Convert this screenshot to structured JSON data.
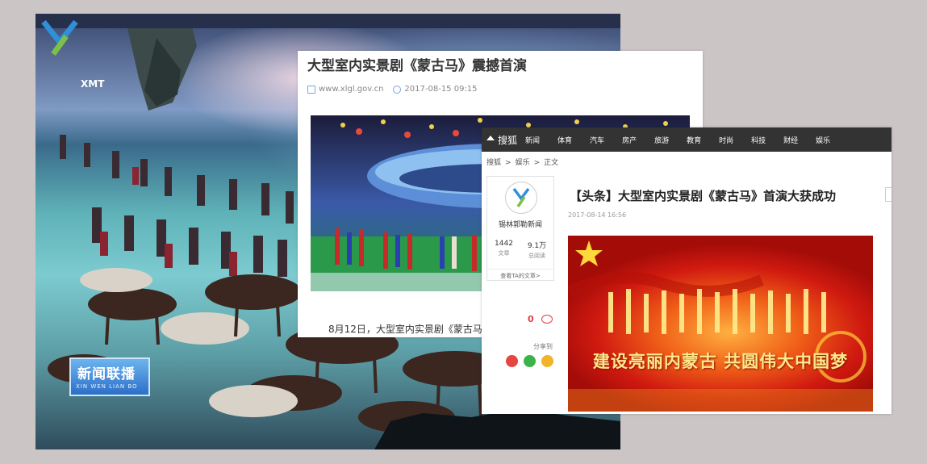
{
  "tv": {
    "logo_text": "XMT",
    "news_badge": "新闻联播",
    "news_badge_en": "XIN WEN LIAN BO"
  },
  "article": {
    "title": "大型室内实景剧《蒙古马》震撼首演",
    "source": "www.xlgl.gov.cn",
    "time": "2017-08-15 09:15",
    "body": "8月12日，大型室内实景剧《蒙古马"
  },
  "sohu": {
    "logo": "搜狐",
    "nav": [
      "新闻",
      "体育",
      "汽车",
      "房产",
      "旅游",
      "教育",
      "时尚",
      "科技",
      "财经",
      "娱乐"
    ],
    "breadcrumb": [
      "搜狐",
      ">",
      "娱乐",
      ">",
      "正文"
    ],
    "author": {
      "name": "锡林郭勒新闻",
      "articles_count": "1442",
      "articles_label": "文章",
      "reads_count": "9.1万",
      "reads_label": "总阅读",
      "more": "查看TA的文章>"
    },
    "comment_count": "0",
    "share_label": "分享到",
    "title": "【头条】大型室内实景剧《蒙古马》首演大获成功",
    "time": "2017-08-14 16:56",
    "banner_text": "建设亮丽内蒙古 共圆伟大中国梦"
  },
  "colors": {
    "background": "#cbc5c6",
    "sohu_nav": "#333333",
    "comment_red": "#e23d3d",
    "banner_red": "#d01a10",
    "banner_text": "#ffe98a"
  }
}
